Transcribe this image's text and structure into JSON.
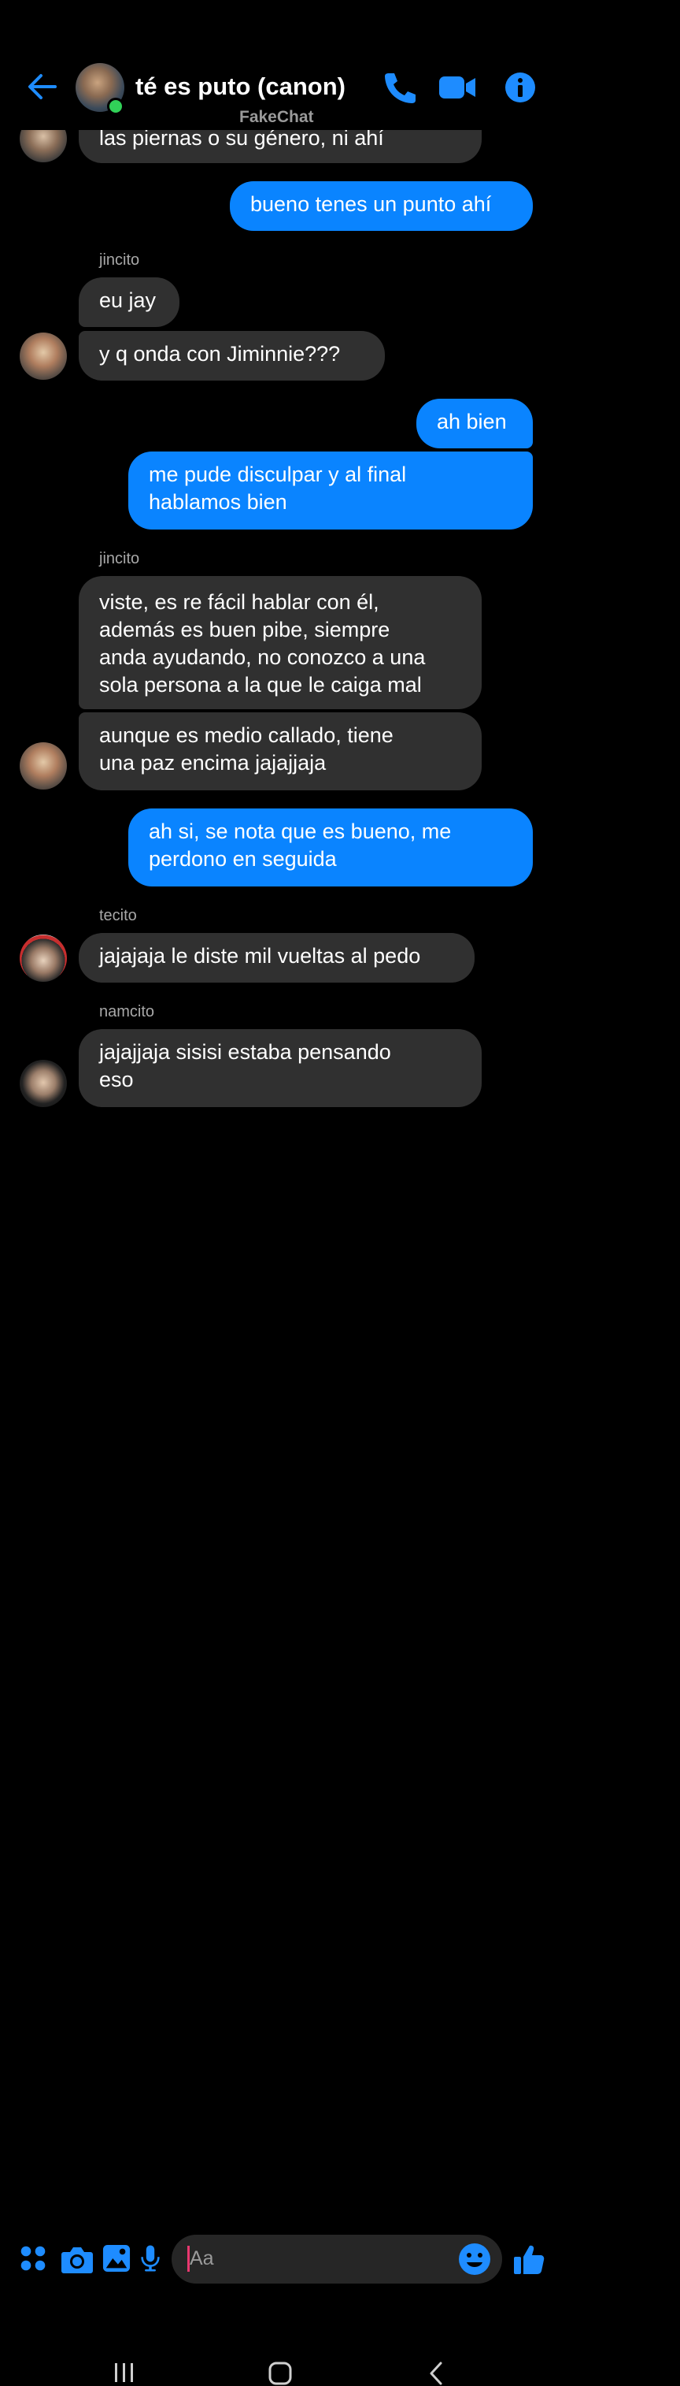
{
  "header": {
    "title": "té es puto (canon)",
    "watermark": "FakeChat"
  },
  "messages": [
    {
      "text": "las piernas o su género, ni ahí",
      "dir": "in"
    },
    {
      "text": "bueno tenes un punto ahí",
      "dir": "out"
    },
    {
      "sender": "jincito"
    },
    {
      "text": "eu jay",
      "dir": "in"
    },
    {
      "text": "y q onda con Jiminnie???",
      "dir": "in"
    },
    {
      "text": "ah bien",
      "dir": "out"
    },
    {
      "text": "me pude disculpar y al final\nhablamos bien",
      "dir": "out"
    },
    {
      "sender": "jincito"
    },
    {
      "text": "viste, es re fácil hablar con él,\nademás es buen pibe, siempre\nanda ayudando, no conozco a una\nsola persona a la que le caiga mal",
      "dir": "in"
    },
    {
      "text": "aunque es medio callado, tiene\nuna paz encima jajajjaja",
      "dir": "in"
    },
    {
      "text": "ah si, se nota que es bueno, me\nperdono en seguida",
      "dir": "out"
    },
    {
      "sender": "tecito"
    },
    {
      "text": "jajajaja le diste mil vueltas al pedo",
      "dir": "in"
    },
    {
      "sender": "namcito"
    },
    {
      "text": "jajajjaja sisisi estaba pensando\neso",
      "dir": "in"
    }
  ],
  "composer": {
    "placeholder": "Aa",
    "icons": [
      "apps-icon",
      "camera-icon",
      "gallery-icon",
      "microphone-icon",
      "emoji-icon",
      "thumbs-up-icon"
    ]
  },
  "colors": {
    "accent": "#0a84ff",
    "incoming_bubble": "#303030",
    "background": "#000000",
    "online": "#31d158"
  }
}
